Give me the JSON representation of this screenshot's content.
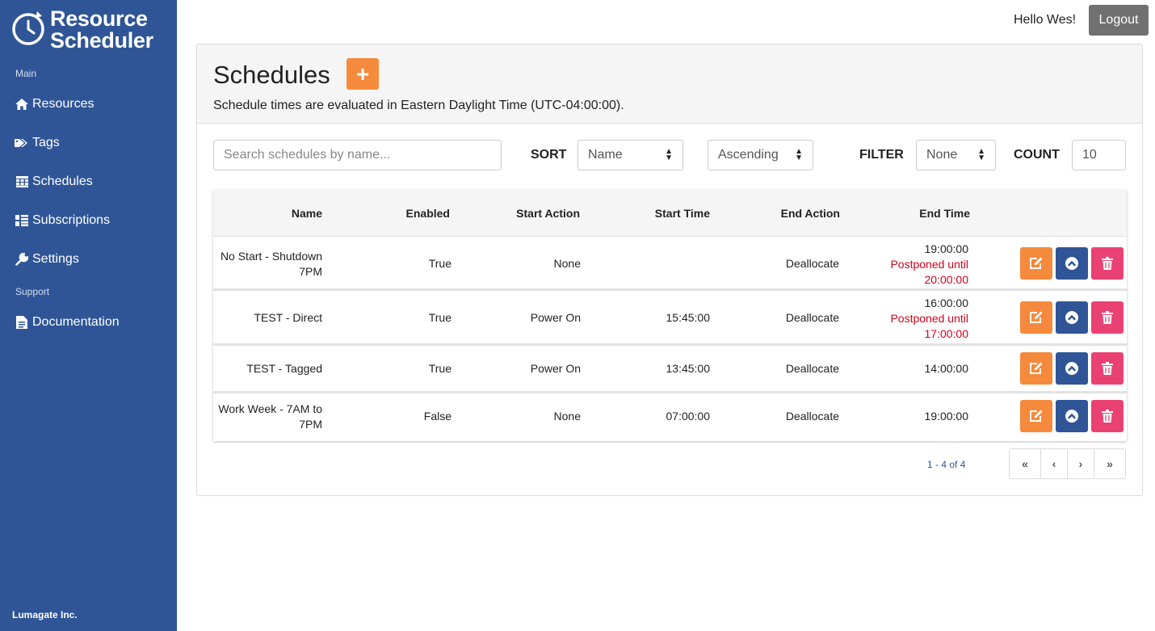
{
  "brand": {
    "line1": "Resource",
    "line2": "Scheduler"
  },
  "sidebar": {
    "section_main": "Main",
    "section_support": "Support",
    "items": [
      {
        "label": "Resources",
        "icon": "home-icon"
      },
      {
        "label": "Tags",
        "icon": "tags-icon"
      },
      {
        "label": "Schedules",
        "icon": "calendar-icon"
      },
      {
        "label": "Subscriptions",
        "icon": "list-icon"
      },
      {
        "label": "Settings",
        "icon": "wrench-icon"
      },
      {
        "label": "Documentation",
        "icon": "document-icon"
      }
    ],
    "footer": "Lumagate Inc."
  },
  "topbar": {
    "greeting": "Hello Wes!",
    "logout_label": "Logout"
  },
  "page": {
    "title": "Schedules",
    "add_label": "+",
    "tz_note": "Schedule times are evaluated in Eastern Daylight Time (UTC-04:00:00)."
  },
  "controls": {
    "search_placeholder": "Search schedules by name...",
    "sort_label": "SORT",
    "sort_field": "Name",
    "sort_order": "Ascending",
    "filter_label": "FILTER",
    "filter_value": "None",
    "count_label": "COUNT",
    "count_value": "10"
  },
  "table": {
    "headers": {
      "name": "Name",
      "enabled": "Enabled",
      "start_action": "Start Action",
      "start_time": "Start Time",
      "end_action": "End Action",
      "end_time": "End Time"
    },
    "rows": [
      {
        "name_line1": "No Start - Shutdown",
        "name_line2": "7PM",
        "enabled": "True",
        "start_action": "None",
        "start_time": "",
        "end_action": "Deallocate",
        "end_time": "19:00:00",
        "postponed_line1": "Postponed until",
        "postponed_line2": "20:00:00"
      },
      {
        "name_line1": "TEST - Direct",
        "name_line2": "",
        "enabled": "True",
        "start_action": "Power On",
        "start_time": "15:45:00",
        "end_action": "Deallocate",
        "end_time": "16:00:00",
        "postponed_line1": "Postponed until",
        "postponed_line2": "17:00:00"
      },
      {
        "name_line1": "TEST - Tagged",
        "name_line2": "",
        "enabled": "True",
        "start_action": "Power On",
        "start_time": "13:45:00",
        "end_action": "Deallocate",
        "end_time": "14:00:00",
        "postponed_line1": "",
        "postponed_line2": ""
      },
      {
        "name_line1": "Work Week - 7AM to",
        "name_line2": "7PM",
        "enabled": "False",
        "start_action": "None",
        "start_time": "07:00:00",
        "end_action": "Deallocate",
        "end_time": "19:00:00",
        "postponed_line1": "",
        "postponed_line2": ""
      }
    ]
  },
  "pagination": {
    "info": "1 - 4 of 4",
    "first": "«",
    "prev": "‹",
    "next": "›",
    "last": "»"
  },
  "colors": {
    "sidebar": "#2f5597",
    "accent_orange": "#f58a3c",
    "delete_pink": "#ea4174",
    "postponed_red": "#d0021b"
  }
}
